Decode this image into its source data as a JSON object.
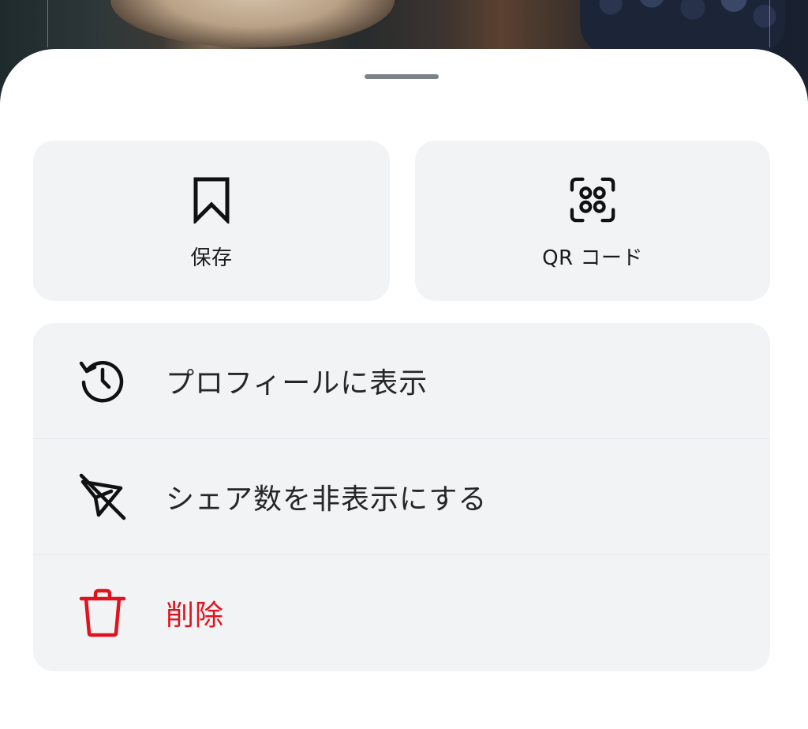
{
  "sheet": {
    "tiles": [
      {
        "label": "保存",
        "icon": "bookmark-icon"
      },
      {
        "label": "QR コード",
        "icon": "qr-scan-icon"
      }
    ],
    "items": [
      {
        "label": "プロフィールに表示",
        "icon": "history-icon"
      },
      {
        "label": "シェア数を非表示にする",
        "icon": "share-off-icon"
      },
      {
        "label": "削除",
        "icon": "trash-icon",
        "color": "#e0141e"
      }
    ]
  },
  "colors": {
    "tile_background": "#f1f3f5",
    "text": "#262626",
    "danger": "#e0141e",
    "handle": "#7d8287"
  }
}
